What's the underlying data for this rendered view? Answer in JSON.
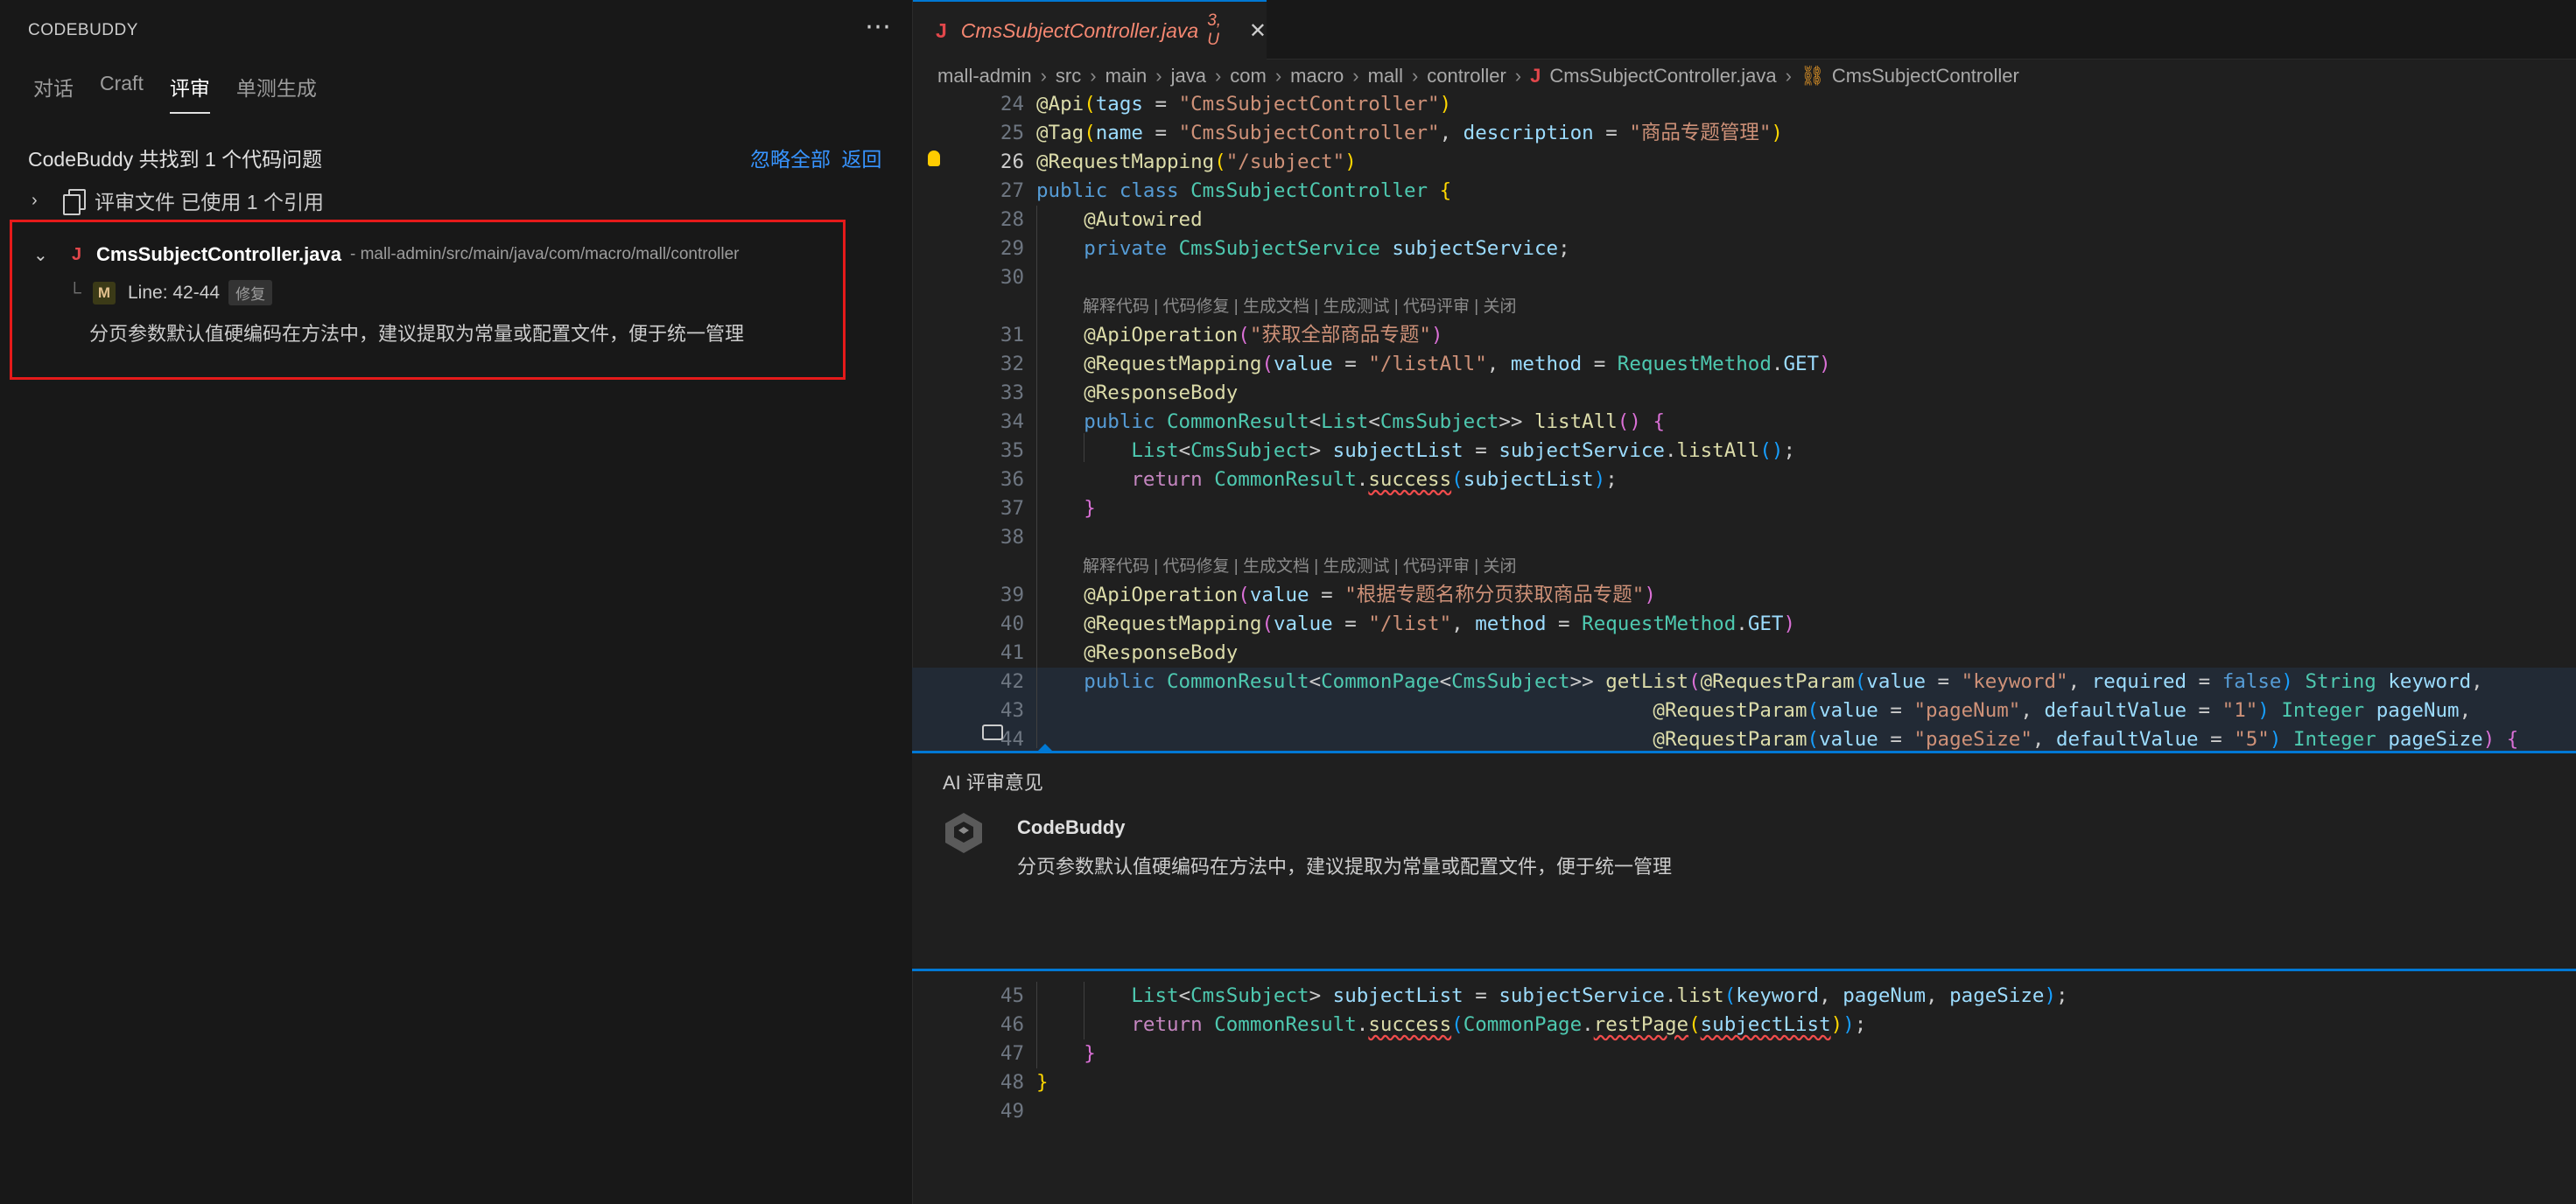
{
  "left_panel": {
    "title": "CODEBUDDY",
    "more_icon": "ellipsis-icon",
    "tabs": [
      {
        "label": "对话",
        "active": false
      },
      {
        "label": "Craft",
        "active": false
      },
      {
        "label": "评审",
        "active": true
      },
      {
        "label": "单测生成",
        "active": false
      }
    ],
    "summary": "CodeBuddy 共找到 1 个代码问题",
    "ignore_all": "忽略全部",
    "back": "返回",
    "references": "评审文件 已使用 1 个引用",
    "issue": {
      "file_icon": "J",
      "file_name": "CmsSubjectController.java",
      "file_path": "- mall-admin/src/main/java/com/macro/mall/controller",
      "severity": "M",
      "line_range": "Line: 42-44",
      "fix_label": "修复",
      "description": "分页参数默认值硬编码在方法中，建议提取为常量或配置文件，便于统一管理"
    }
  },
  "editor": {
    "tab": {
      "icon": "J",
      "name": "CmsSubjectController.java",
      "status": "3, U",
      "close": "✕"
    },
    "breadcrumb": [
      "mall-admin",
      "src",
      "main",
      "java",
      "com",
      "macro",
      "mall",
      "controller"
    ],
    "breadcrumb_file": "CmsSubjectController.java",
    "breadcrumb_class": "CmsSubjectController",
    "codelens": "解释代码 | 代码修复 | 生成文档 | 生成测试 | 代码评审 | 关闭",
    "line_numbers": [
      "24",
      "25",
      "26",
      "27",
      "28",
      "29",
      "30",
      "31",
      "32",
      "33",
      "34",
      "35",
      "36",
      "37",
      "38",
      "39",
      "40",
      "41",
      "42",
      "43",
      "44",
      "45",
      "46",
      "47",
      "48",
      "49"
    ],
    "review": {
      "heading": "AI 评审意见",
      "author": "CodeBuddy",
      "comment": "分页参数默认值硬编码在方法中，建议提取为常量或配置文件，便于统一管理"
    }
  },
  "colors": {
    "accent": "#0078d4",
    "highlight_border": "#e51a1a",
    "link": "#3794ff",
    "modified_tab": "#f48771"
  }
}
